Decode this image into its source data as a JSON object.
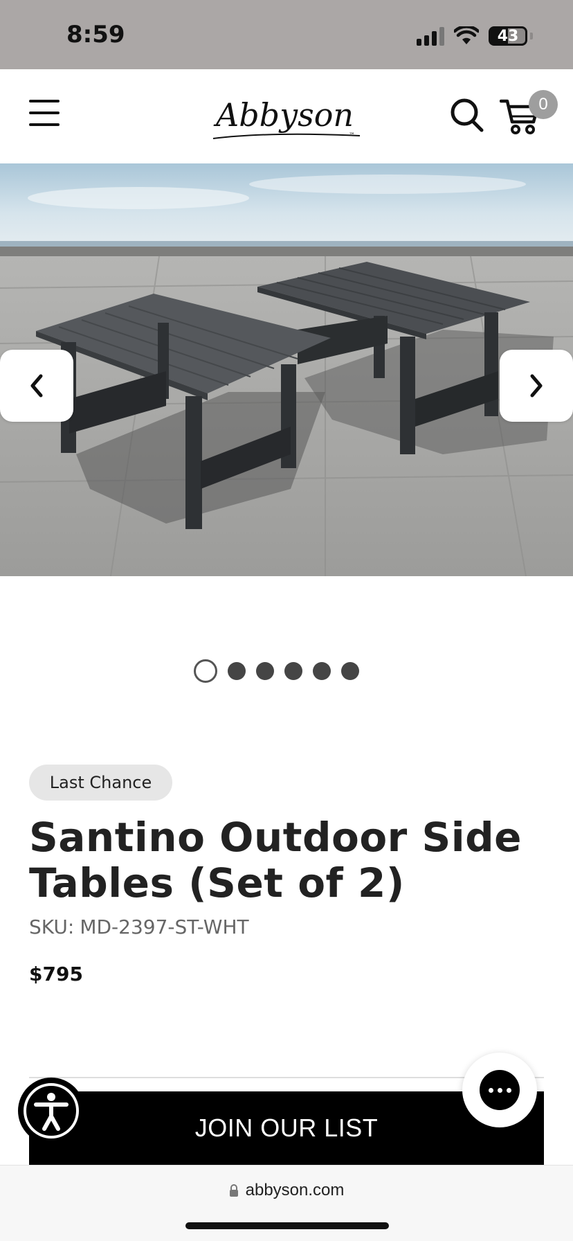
{
  "status_bar": {
    "time": "8:59",
    "battery": "43",
    "icons": [
      "signal-icon",
      "wifi-icon",
      "battery-icon"
    ]
  },
  "header": {
    "logo_text": "Abbyson",
    "logo_mark": "™",
    "cart_count": "0",
    "icons": [
      "menu-icon",
      "search-icon",
      "cart-icon"
    ]
  },
  "gallery": {
    "total_slides": 6,
    "active_slide": 1,
    "icons": [
      "chevron-left-icon",
      "chevron-right-icon"
    ]
  },
  "product": {
    "badge": "Last Chance",
    "title": "Santino Outdoor Side Tables (Set of 2)",
    "sku_label": "SKU:",
    "sku": "MD-2397-ST-WHT",
    "price": "$795"
  },
  "newsletter": {
    "button_label": "JOIN OUR LIST"
  },
  "widgets": {
    "icons": [
      "accessibility-icon",
      "chat-icon"
    ]
  },
  "browser": {
    "url": "abbyson.com",
    "icons": [
      "lock-icon"
    ]
  },
  "colors": {
    "status_bar_bg": "#aba7a6",
    "primary": "#000000",
    "badge_bg": "#e6e6e6",
    "dot": "#454545"
  }
}
